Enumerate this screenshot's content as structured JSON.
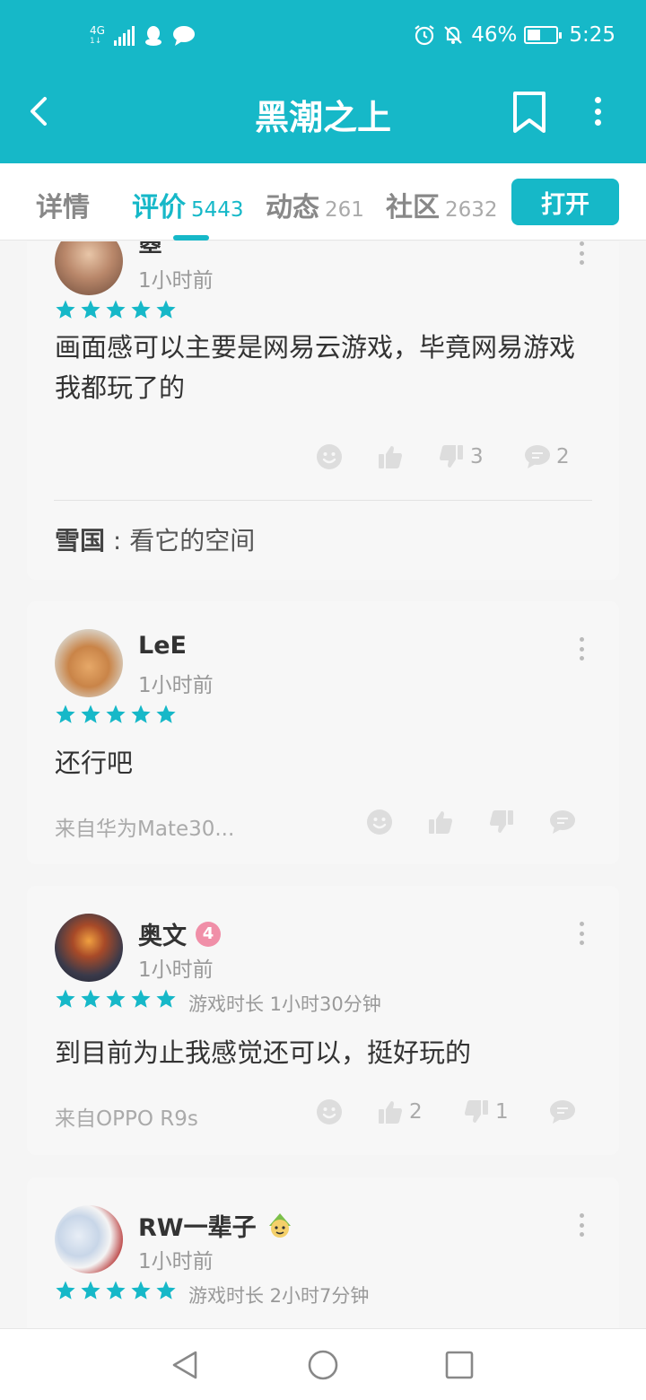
{
  "status": {
    "network": "4G",
    "network_sub": "1↓",
    "battery": "46%",
    "battery_level": 0.46,
    "time": "5:25",
    "icons": [
      "signal-icon",
      "qq-icon",
      "chat-icon",
      "alarm-icon",
      "mute-icon",
      "battery-icon"
    ]
  },
  "header": {
    "title": "黑潮之上",
    "icons": [
      "back-icon",
      "bookmark-icon",
      "more-icon"
    ]
  },
  "tabs": [
    {
      "label": "详情",
      "count": ""
    },
    {
      "label": "评价",
      "count": "5443"
    },
    {
      "label": "动态",
      "count": "261"
    },
    {
      "label": "社区",
      "count": "2632"
    }
  ],
  "open_button": "打开",
  "reviews": [
    {
      "username": "曌",
      "time": "1小时前",
      "stars": 5,
      "playtime": "",
      "text": "画面感可以主要是网易云游戏，毕竟网易游戏我都玩了的",
      "device": "",
      "likes": "",
      "dislikes": "3",
      "comments": "2",
      "reply": {
        "author": "雪国",
        "sep": " : ",
        "text": "看它的空间"
      }
    },
    {
      "username": "LeE",
      "time": "1小时前",
      "stars": 5,
      "playtime": "",
      "text": "还行吧",
      "device": "来自华为Mate30...",
      "likes": "",
      "dislikes": "",
      "comments": ""
    },
    {
      "username": "奥文",
      "badge": "4",
      "time": "1小时前",
      "stars": 5,
      "playtime": "游戏时长 1小时30分钟",
      "text": "到目前为止我感觉还可以，挺好玩的",
      "device": "来自OPPO R9s",
      "likes": "2",
      "dislikes": "1",
      "comments": ""
    },
    {
      "username": "RW一辈子",
      "time": "1小时前",
      "stars": 5,
      "playtime": "游戏时长 2小时7分钟"
    }
  ],
  "colors": {
    "accent": "#16b8c8",
    "star": "#16b8c8",
    "badge": "#f08fa8"
  }
}
